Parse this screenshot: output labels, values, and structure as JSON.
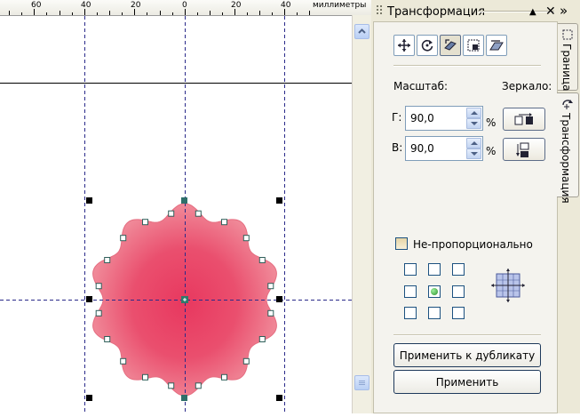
{
  "ruler": {
    "ticks": [
      "60",
      "40",
      "20",
      "0",
      "20",
      "40"
    ],
    "unit": "миллиметры"
  },
  "docker": {
    "title": "Трансформация",
    "scale_label": "Масштаб:",
    "mirror_label": "Зеркало:",
    "h_label": "Г:",
    "h_value": "90,0",
    "v_label": "В:",
    "v_value": "90,0",
    "percent": "%",
    "nonproportional_label": "Не-пропорционально",
    "nonproportional_checked": false,
    "apply_duplicate_label": "Применить к дубликату",
    "apply_label": "Применить",
    "anchor_selected": "center",
    "modes": [
      "move-icon",
      "rotate-icon",
      "scale-icon",
      "size-icon",
      "skew-icon"
    ],
    "active_mode": "scale-icon"
  },
  "side_tabs": [
    "Граница",
    "Трансформация"
  ],
  "colors": {
    "shape_outer": "#ef8a98",
    "shape_center": "#e8385f",
    "guide": "#2a2a8a",
    "panel_bg": "#ece9d8"
  }
}
